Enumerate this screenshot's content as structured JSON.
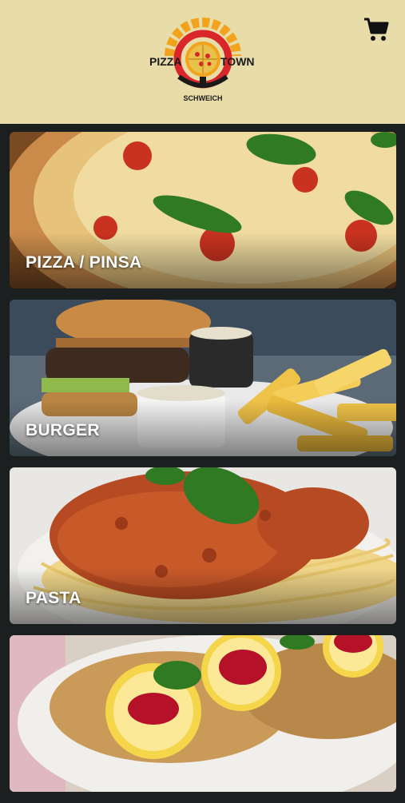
{
  "header": {
    "logo": {
      "name_left": "PIZZA",
      "name_right": "TOWN",
      "subtitle": "SCHWEICH"
    },
    "cart_icon": "shopping-cart-icon"
  },
  "categories": [
    {
      "label": "PIZZA / PINSA"
    },
    {
      "label": "BURGER"
    },
    {
      "label": "PASTA"
    },
    {
      "label": ""
    }
  ],
  "colors": {
    "header_bg": "#e8dca8",
    "page_bg": "#1c1f1f",
    "logo_red": "#d9262b",
    "logo_orange": "#f2a31c"
  }
}
